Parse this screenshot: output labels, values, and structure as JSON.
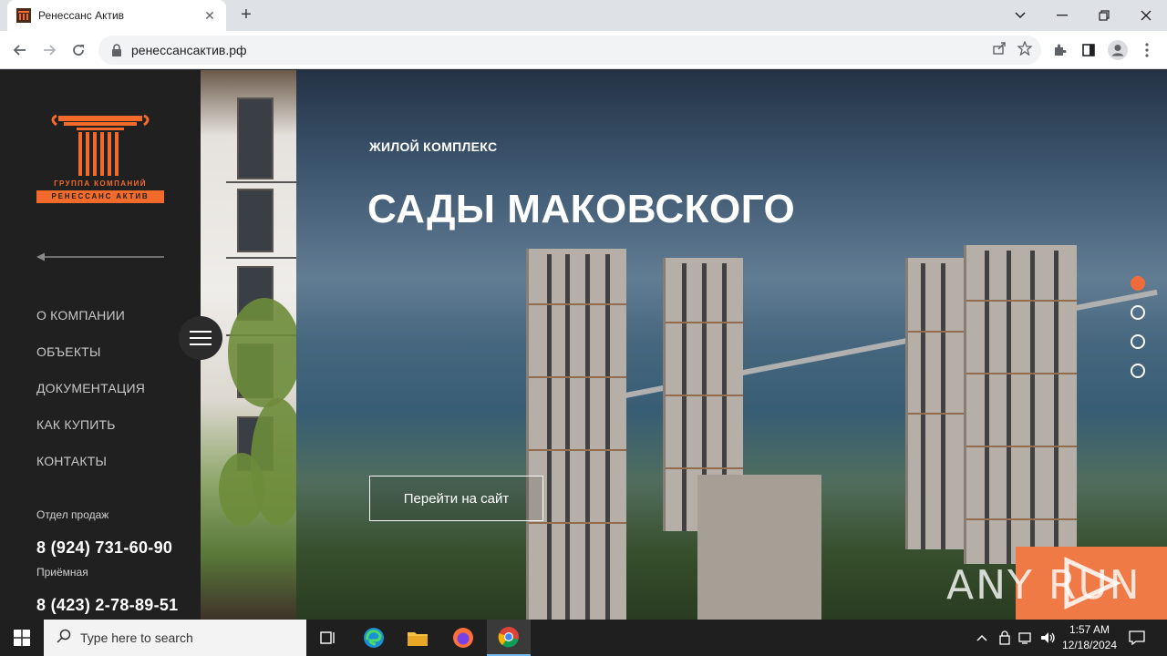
{
  "browser": {
    "tab_title": "Ренессанс Актив",
    "url": "ренессансактив.рф",
    "new_tab_label": "+",
    "close_tab_label": "✕"
  },
  "sidebar": {
    "logo_line1": "ГРУППА КОМПАНИЙ",
    "logo_line2": "РЕНЕССАНС АКТИВ",
    "nav": [
      {
        "label": "О КОМПАНИИ"
      },
      {
        "label": "ОБЪЕКТЫ"
      },
      {
        "label": "ДОКУМЕНТАЦИЯ"
      },
      {
        "label": "КАК КУПИТЬ"
      },
      {
        "label": "КОНТАКТЫ"
      }
    ],
    "sales_label": "Отдел продаж",
    "sales_phone": "8 (924) 731-60-90",
    "reception_label": "Приёмная",
    "reception_phone": "8 (423) 2-78-89-51"
  },
  "hero": {
    "subtitle": "ЖИЛОЙ КОМПЛЕКС",
    "title": "САДЫ МАКОВСКОГО",
    "cta_label": "Перейти на сайт",
    "slides_total": 4,
    "active_slide": 1
  },
  "watermark": {
    "text": "ANY RUN"
  },
  "taskbar": {
    "search_placeholder": "Type here to search",
    "time": "1:57 AM",
    "date": "12/18/2024"
  },
  "colors": {
    "accent": "#f26b2a",
    "sidebar_bg": "#202020",
    "taskbar_bg": "#1f1f1f"
  }
}
